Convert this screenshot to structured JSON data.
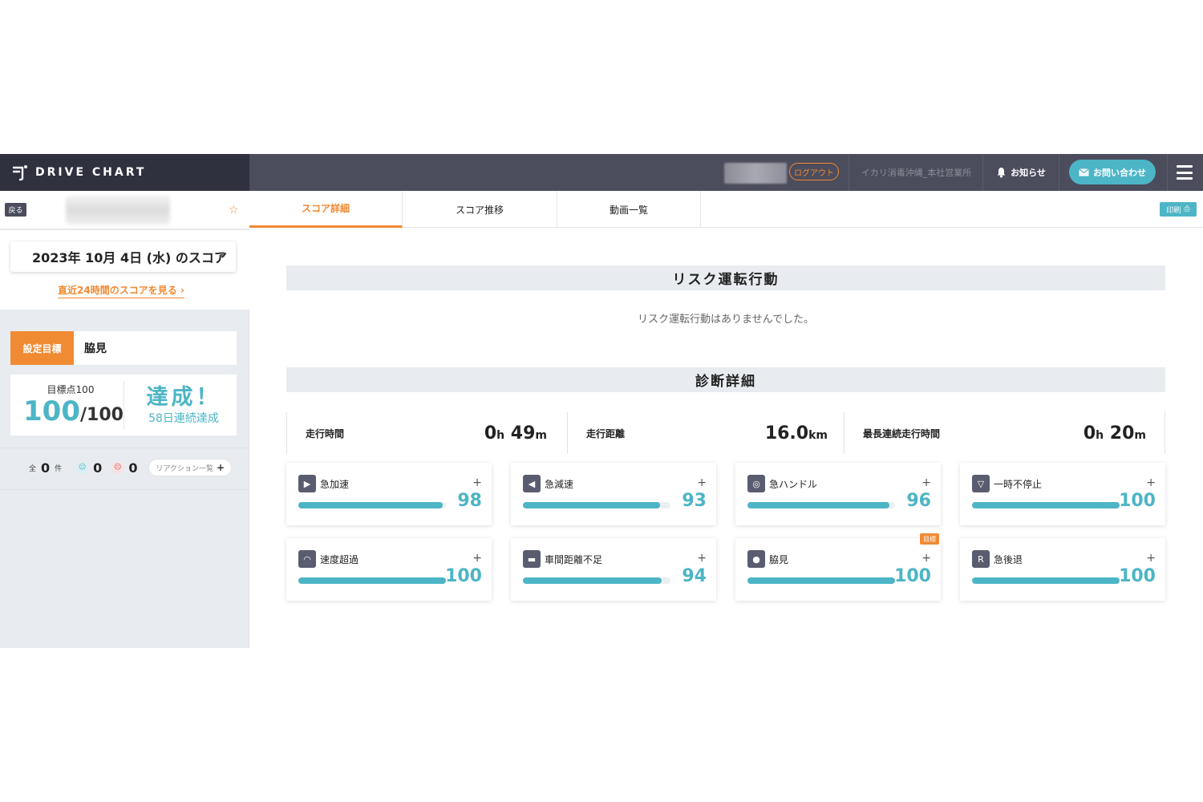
{
  "header": {
    "brand": "DRIVE CHART",
    "logout": "ログアウト",
    "office": "イカリ消毒沖縄_本社営業所",
    "notice": "お知らせ",
    "contact": "お問い合わせ"
  },
  "sidebar": {
    "back": "戻る",
    "date": "2023年 10月 4日 (水) のスコア",
    "recent_link": "直近24時間のスコアを見る ›",
    "goal_tag": "設定目標",
    "goal_value": "脇見",
    "score_target": "目標点100",
    "score": "100",
    "score_denominator": "/100",
    "achieved": "達成！",
    "streak": "58日連続達成",
    "reactions": {
      "total_prefix": "全",
      "total": "0",
      "total_suffix": "件",
      "happy": "0",
      "sad": "0",
      "list_label": "リアクション一覧"
    }
  },
  "tabs": [
    "スコア詳細",
    "スコア推移",
    "動画一覧"
  ],
  "print": "印刷",
  "main": {
    "risk_title": "リスク運転行動",
    "risk_message": "リスク運転行動はありませんでした。",
    "diagnosis_title": "診断詳細",
    "stats": [
      {
        "label": "走行時間",
        "value": "0h 49m"
      },
      {
        "label": "走行距離",
        "value": "16.0km"
      },
      {
        "label": "最長連続走行時間",
        "value": "0h 20m"
      }
    ],
    "cards": [
      {
        "title": "急加速",
        "score": "98",
        "icon": "acceleration-icon",
        "glyph": "▶"
      },
      {
        "title": "急減速",
        "score": "93",
        "icon": "deceleration-icon",
        "glyph": "◀"
      },
      {
        "title": "急ハンドル",
        "score": "96",
        "icon": "steering-icon",
        "glyph": "◎"
      },
      {
        "title": "一時不停止",
        "score": "100",
        "icon": "stop-sign-icon",
        "glyph": "▽"
      },
      {
        "title": "速度超過",
        "score": "100",
        "icon": "speedometer-icon",
        "glyph": "◠"
      },
      {
        "title": "車間距離不足",
        "score": "94",
        "icon": "following-distance-icon",
        "glyph": "▬"
      },
      {
        "title": "脇見",
        "score": "100",
        "icon": "distraction-icon",
        "glyph": "●",
        "badge": "目標"
      },
      {
        "title": "急後退",
        "score": "100",
        "icon": "reverse-icon",
        "glyph": "R"
      }
    ]
  },
  "colors": {
    "accent": "#f08a33",
    "teal": "#4cb5c6",
    "header": "#4b4c5c"
  }
}
